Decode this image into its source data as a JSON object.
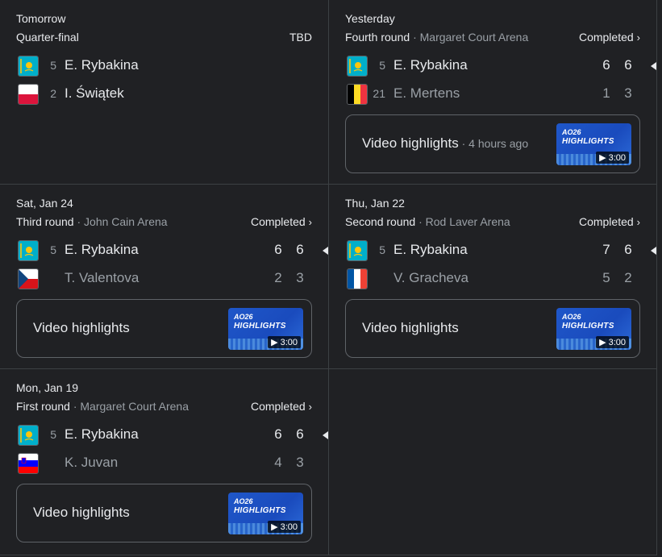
{
  "matches": [
    {
      "date": "Tomorrow",
      "round": "Quarter-final",
      "venue": "",
      "status": "TBD",
      "players": [
        {
          "seed": "5",
          "name": "E. Rybakina",
          "flag": "kazakhstan-flag-icon",
          "scores": []
        },
        {
          "seed": "2",
          "name": "I. Świątek",
          "flag": "poland-flag-icon",
          "scores": []
        }
      ]
    },
    {
      "date": "Yesterday",
      "round": "Fourth round",
      "venue": "· Margaret Court Arena",
      "status": "Completed",
      "players": [
        {
          "seed": "5",
          "name": "E. Rybakina",
          "flag": "kazakhstan-flag-icon",
          "scores": [
            "6",
            "6"
          ]
        },
        {
          "seed": "21",
          "name": "E. Mertens",
          "flag": "belgium-flag-icon",
          "scores": [
            "1",
            "3"
          ]
        }
      ],
      "video": {
        "label": "Video highlights",
        "ago": " · 4 hours ago",
        "duration": "▶ 3:00",
        "logo": "AO26",
        "badge": "HIGHLIGHTS"
      }
    },
    {
      "date": "Sat, Jan 24",
      "round": "Third round",
      "venue": "· John Cain Arena",
      "status": "Completed",
      "players": [
        {
          "seed": "5",
          "name": "E. Rybakina",
          "flag": "kazakhstan-flag-icon",
          "scores": [
            "6",
            "6"
          ]
        },
        {
          "seed": "",
          "name": "T. Valentova",
          "flag": "czechia-flag-icon",
          "scores": [
            "2",
            "3"
          ]
        }
      ],
      "video": {
        "label": "Video highlights",
        "ago": "",
        "duration": "▶ 3:00",
        "logo": "AO26",
        "badge": "HIGHLIGHTS"
      }
    },
    {
      "date": "Thu, Jan 22",
      "round": "Second round",
      "venue": "· Rod Laver Arena",
      "status": "Completed",
      "players": [
        {
          "seed": "5",
          "name": "E. Rybakina",
          "flag": "kazakhstan-flag-icon",
          "scores": [
            "7",
            "6"
          ]
        },
        {
          "seed": "",
          "name": "V. Gracheva",
          "flag": "france-flag-icon",
          "scores": [
            "5",
            "2"
          ]
        }
      ],
      "video": {
        "label": "Video highlights",
        "ago": "",
        "duration": "▶ 3:00",
        "logo": "AO26",
        "badge": "HIGHLIGHTS"
      }
    },
    {
      "date": "Mon, Jan 19",
      "round": "First round",
      "venue": "· Margaret Court Arena",
      "status": "Completed",
      "players": [
        {
          "seed": "5",
          "name": "E. Rybakina",
          "flag": "kazakhstan-flag-icon",
          "scores": [
            "6",
            "6"
          ]
        },
        {
          "seed": "",
          "name": "K. Juvan",
          "flag": "slovenia-flag-icon",
          "scores": [
            "4",
            "3"
          ]
        }
      ],
      "video": {
        "label": "Video highlights",
        "ago": "",
        "duration": "▶ 3:00",
        "logo": "AO26",
        "badge": "HIGHLIGHTS"
      }
    }
  ],
  "icons": {
    "chevron": "chevron-right-icon",
    "winner": "winner-arrow-icon"
  },
  "colors": {
    "background": "#202124",
    "text": "#e8eaed",
    "muted": "#9aa0a6",
    "border": "#3c4043"
  }
}
